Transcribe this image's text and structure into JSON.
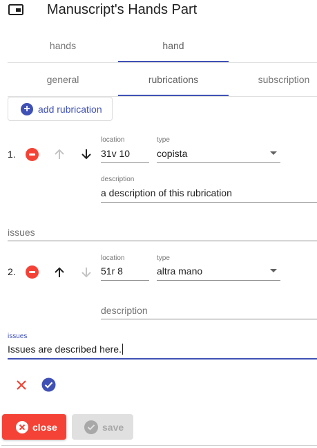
{
  "header": {
    "title": "Manuscript's Hands Part",
    "icon": "part-window-icon"
  },
  "top_tabs": [
    {
      "label": "hands",
      "selected": false
    },
    {
      "label": "hand",
      "selected": true
    }
  ],
  "sub_tabs": [
    {
      "label": "general",
      "selected": false
    },
    {
      "label": "rubrications",
      "selected": true
    },
    {
      "label": "subscription",
      "selected": false
    }
  ],
  "add_button": {
    "label": "add rubrication",
    "icon": "add-circle-icon"
  },
  "rubrications": [
    {
      "index": "1.",
      "location_label": "location",
      "location": "31v 10",
      "type_label": "type",
      "type": "copista",
      "description_label": "description",
      "description": "a description of this rubrication",
      "up_enabled": false,
      "down_enabled": true
    },
    {
      "index": "2.",
      "location_label": "location",
      "location": "51r 8",
      "type_label": "type",
      "type": "altra mano",
      "description_placeholder": "description",
      "description": "",
      "up_enabled": true,
      "down_enabled": false
    }
  ],
  "issues_placeholder": "issues",
  "issues_field": {
    "label": "issues",
    "value": "Issues are described here."
  },
  "actions": {
    "cancel_icon": "close-icon",
    "accept_icon": "check-circle-icon"
  },
  "footer": {
    "close_label": "close",
    "save_label": "save",
    "save_enabled": false
  },
  "colors": {
    "primary": "#3f51b5",
    "warn": "#f44336",
    "disabled": "#a8a8a8"
  }
}
